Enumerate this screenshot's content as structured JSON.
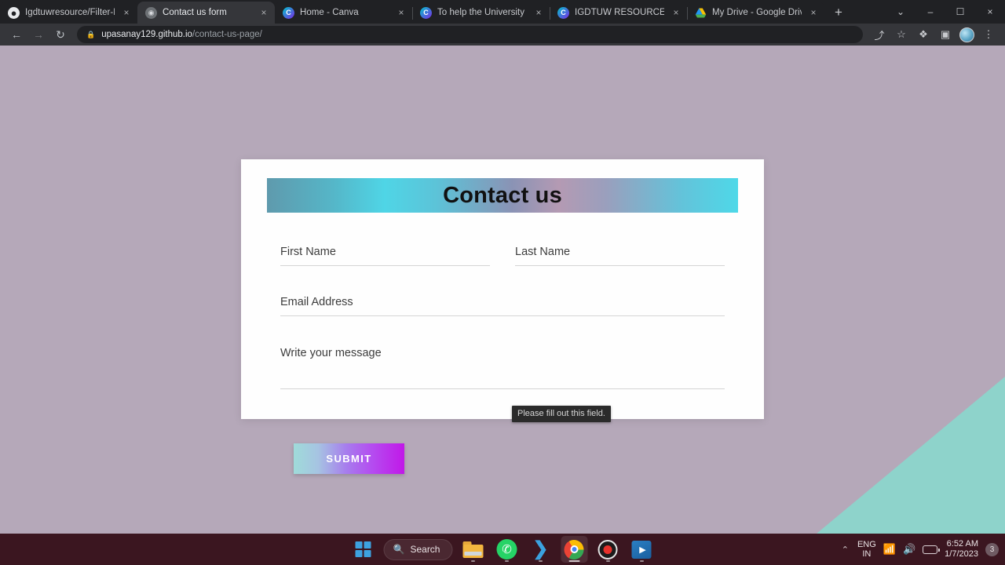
{
  "browser": {
    "tabs": [
      {
        "title": "Igdtuwresource/Filter-Page",
        "favicon": "github-icon",
        "active": false,
        "close": "×"
      },
      {
        "title": "Contact us form",
        "favicon": "generic-page-icon",
        "active": true,
        "close": "×"
      },
      {
        "title": "Home - Canva",
        "favicon": "canva-icon",
        "active": false,
        "close": "×"
      },
      {
        "title": "To help the University stude",
        "favicon": "canva-icon",
        "active": false,
        "close": "×"
      },
      {
        "title": "IGDTUW RESOURCE - Vide",
        "favicon": "canva-icon",
        "active": false,
        "close": "×"
      },
      {
        "title": "My Drive - Google Drive",
        "favicon": "google-drive-icon",
        "active": false,
        "close": "×"
      }
    ],
    "new_tab_label": "+",
    "window_controls": {
      "tab_search": "⌄",
      "minimize": "–",
      "maximize": "☐",
      "close": "×"
    },
    "nav": {
      "back": "←",
      "forward": "→",
      "reload": "↻"
    },
    "omnibox": {
      "lock": "🔒",
      "host": "upasanay129.github.io",
      "path": "/contact-us-page/"
    },
    "toolbar_icons": {
      "share": "⤴",
      "bookmark": "☆",
      "extensions": "❖",
      "side_panel": "▣",
      "profile": "profile-avatar",
      "menu": "⋮"
    }
  },
  "page": {
    "heading": "Contact us",
    "fields": {
      "first_name": {
        "placeholder": "First Name",
        "value": ""
      },
      "last_name": {
        "placeholder": "Last Name",
        "value": ""
      },
      "email": {
        "placeholder": "Email Address",
        "value": ""
      },
      "message": {
        "placeholder": "Write your message",
        "value": ""
      }
    },
    "validation_tooltip": "Please fill out this field.",
    "submit_label": "SUBMIT",
    "colors": {
      "background": "#b5a8b9",
      "wedge": "#8ed3cb",
      "card": "#fefefe",
      "header_gradient_start": "#5f9aad",
      "header_gradient_cyan": "#4fd5e6",
      "header_gradient_mauve": "#b49ab3",
      "submit_gradient_start": "#9fdbd9",
      "submit_gradient_end": "#c118e8",
      "tooltip_bg": "#2b2b2b"
    }
  },
  "taskbar": {
    "start": "windows-start-icon",
    "search_label": "Search",
    "search_glyph": "🔍",
    "apps": [
      {
        "name": "file-explorer",
        "active": false
      },
      {
        "name": "whatsapp",
        "active": false
      },
      {
        "name": "vs-code",
        "active": false
      },
      {
        "name": "google-chrome",
        "active": true
      },
      {
        "name": "screen-recorder",
        "active": false
      },
      {
        "name": "media-player",
        "active": false
      }
    ],
    "tray": {
      "chevron": "⌃",
      "language_line1": "ENG",
      "language_line2": "IN",
      "wifi": "📶",
      "volume": "🔊",
      "battery": "battery-icon",
      "time": "6:52 AM",
      "date": "1/7/2023",
      "notification_count": "3"
    }
  }
}
